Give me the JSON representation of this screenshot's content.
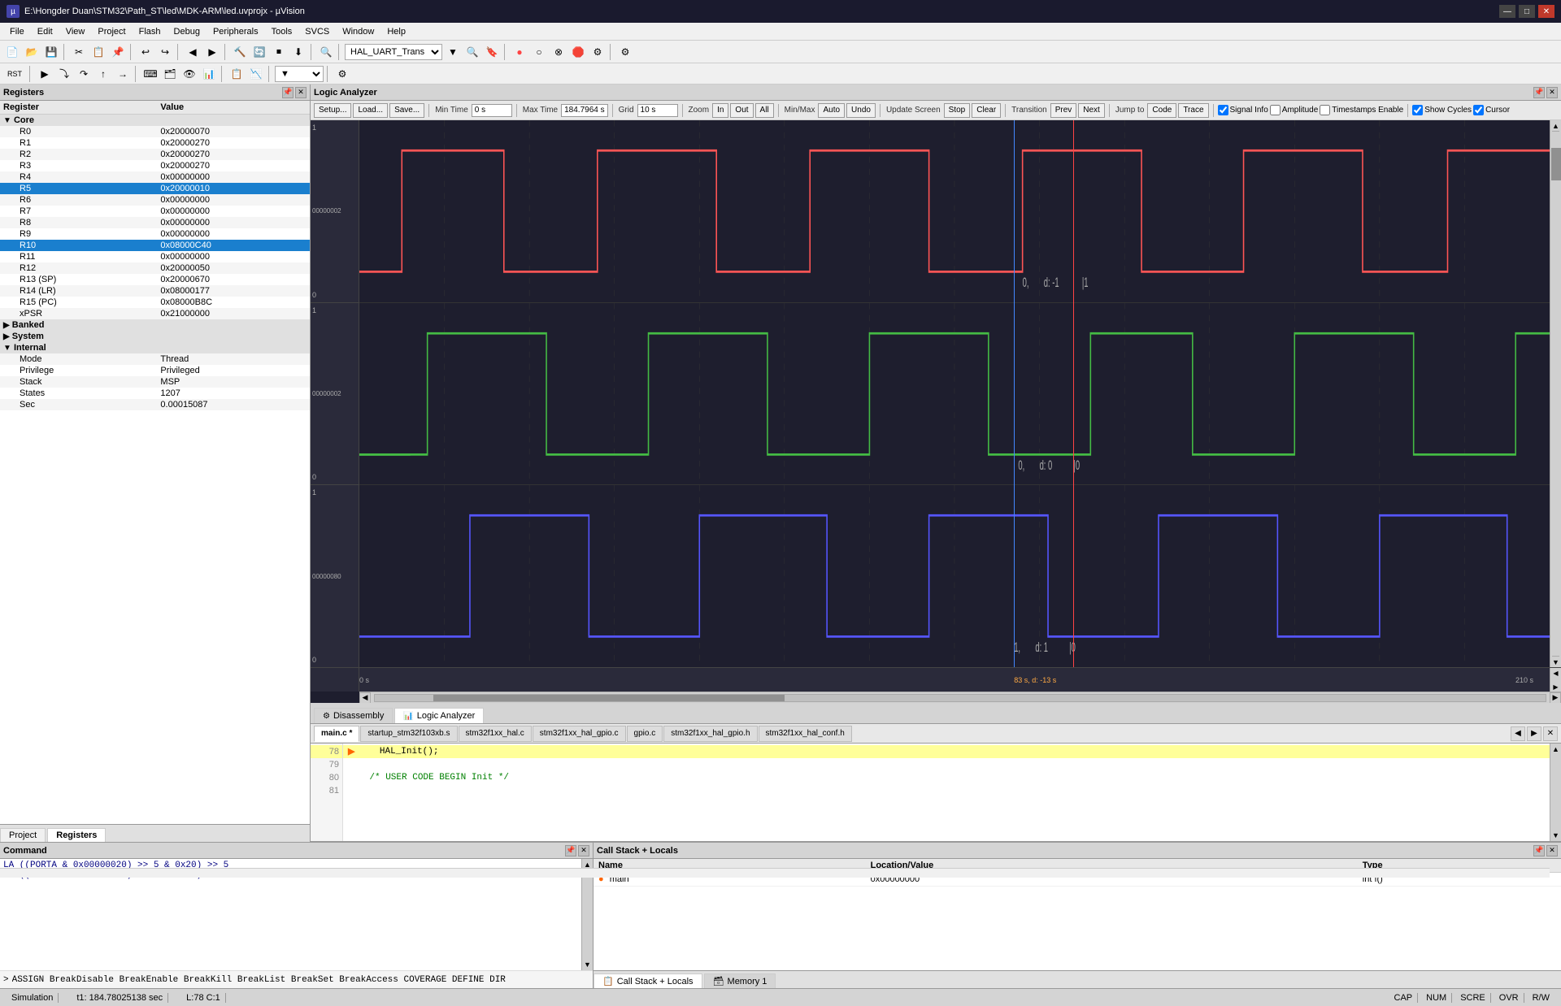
{
  "titlebar": {
    "text": "E:\\Hongder Duan\\STM32\\Path_ST\\led\\MDK-ARM\\led.uvprojx - µVision",
    "icon": "µ"
  },
  "menubar": {
    "items": [
      "File",
      "Edit",
      "View",
      "Project",
      "Flash",
      "Debug",
      "Peripherals",
      "Tools",
      "SVCS",
      "Window",
      "Help"
    ]
  },
  "toolbar": {
    "combo_value": "HAL_UART_Trans"
  },
  "registers": {
    "title": "Registers",
    "columns": [
      "Register",
      "Value"
    ],
    "sections": {
      "core": {
        "label": "Core",
        "registers": [
          {
            "name": "R0",
            "value": "0x20000070",
            "selected": false
          },
          {
            "name": "R1",
            "value": "0x20000270",
            "selected": false
          },
          {
            "name": "R2",
            "value": "0x20000270",
            "selected": false
          },
          {
            "name": "R3",
            "value": "0x20000270",
            "selected": false
          },
          {
            "name": "R4",
            "value": "0x00000000",
            "selected": false
          },
          {
            "name": "R5",
            "value": "0x20000010",
            "selected": true
          },
          {
            "name": "R6",
            "value": "0x00000000",
            "selected": false
          },
          {
            "name": "R7",
            "value": "0x00000000",
            "selected": false
          },
          {
            "name": "R8",
            "value": "0x00000000",
            "selected": false
          },
          {
            "name": "R9",
            "value": "0x00000000",
            "selected": false
          },
          {
            "name": "R10",
            "value": "0x08000C40",
            "selected": true
          },
          {
            "name": "R11",
            "value": "0x00000000",
            "selected": false
          },
          {
            "name": "R12",
            "value": "0x20000050",
            "selected": false
          },
          {
            "name": "R13 (SP)",
            "value": "0x20000670",
            "selected": false
          },
          {
            "name": "R14 (LR)",
            "value": "0x08000177",
            "selected": false
          },
          {
            "name": "R15 (PC)",
            "value": "0x08000B8C",
            "selected": false
          },
          {
            "name": "xPSR",
            "value": "0x21000000",
            "selected": false
          }
        ]
      },
      "banked": {
        "label": "Banked"
      },
      "system": {
        "label": "System"
      },
      "internal": {
        "label": "Internal",
        "rows": [
          {
            "name": "Mode",
            "value": "Thread"
          },
          {
            "name": "Privilege",
            "value": "Privileged"
          },
          {
            "name": "Stack",
            "value": "MSP"
          },
          {
            "name": "States",
            "value": "1207"
          },
          {
            "name": "Sec",
            "value": "0.00015087"
          }
        ]
      }
    }
  },
  "left_tabs": [
    {
      "label": "Project",
      "active": false
    },
    {
      "label": "Registers",
      "active": true
    }
  ],
  "logic_analyzer": {
    "title": "Logic Analyzer",
    "toolbar": {
      "setup_btn": "Setup...",
      "load_btn": "Load...",
      "save_btn": "Save...",
      "min_time_label": "Min Time",
      "min_time_val": "0 s",
      "max_time_label": "Max Time",
      "max_time_val": "184.7964 s",
      "grid_label": "Grid",
      "grid_val": "10 s",
      "zoom_label": "Zoom",
      "zoom_in": "In",
      "zoom_out": "Out",
      "zoom_all": "All",
      "minmax_label": "Min/Max",
      "auto_btn": "Auto",
      "undo_btn": "Undo",
      "update_screen_label": "Update Screen",
      "stop_btn": "Stop",
      "clear_btn": "Clear",
      "transition_label": "Transition",
      "prev_btn": "Prev",
      "next_btn": "Next",
      "jump_to_label": "Jump to",
      "code_btn": "Code",
      "trace_btn": "Trace",
      "signal_info_label": "Signal Info",
      "amplitude_label": "Amplitude",
      "timestamps_label": "Timestamps Enable",
      "show_cycles_label": "Show Cycles",
      "cursor_label": "Cursor"
    },
    "signals": [
      {
        "id": "s1",
        "bits": "00000002",
        "color": "#ff4444",
        "values": "0,d:-1,1"
      },
      {
        "id": "s2",
        "bits": "00000002",
        "color": "#44bb44",
        "values": "0,d:0,0"
      },
      {
        "id": "s3",
        "bits": "00000080",
        "color": "#4444ff",
        "values": "1,d:1,0"
      }
    ],
    "time_start": "0 s",
    "time_end": "210 s",
    "cursor_time": "83 s, d: -13 s",
    "cursor_blue_pct": 55,
    "cursor_red_pct": 60
  },
  "code_tabs": [
    {
      "label": "Disassembly",
      "icon": "⚙",
      "active": false
    },
    {
      "label": "Logic Analyzer",
      "icon": "📊",
      "active": true
    }
  ],
  "file_tabs": [
    {
      "label": "main.c *",
      "active": true
    },
    {
      "label": "startup_stm32f103xb.s",
      "active": false
    },
    {
      "label": "stm32f1xx_hal.c",
      "active": false
    },
    {
      "label": "stm32f1xx_hal_gpio.c",
      "active": false
    },
    {
      "label": "gpio.c",
      "active": false
    },
    {
      "label": "stm32f1xx_hal_gpio.h",
      "active": false
    },
    {
      "label": "stm32f1xx_hal_conf.h",
      "active": false
    }
  ],
  "code_editor": {
    "lines": [
      {
        "num": 78,
        "content": "    HAL_Init();",
        "active": true,
        "arrow": true
      },
      {
        "num": 79,
        "content": "",
        "active": false,
        "arrow": false
      },
      {
        "num": 80,
        "content": "    /* USER CODE BEGIN Init */",
        "active": false,
        "arrow": false
      },
      {
        "num": 81,
        "content": "",
        "active": false,
        "arrow": false
      }
    ]
  },
  "command": {
    "title": "Command",
    "lines": [
      "LA ((PORTA & 0x00000020) >> 5 & 0x20) >> 5",
      "LA ((PORTA & 0x00000080) >> 7 & 0x80) >> 7"
    ],
    "prompt": ">",
    "input_text": "ASSIGN BreakDisable BreakEnable BreakKill BreakList BreakSet BreakAccess COVERAGE DEFINE DIR"
  },
  "callstack": {
    "title": "Call Stack + Locals",
    "columns": [
      "Name",
      "Location/Value",
      "Type"
    ],
    "rows": [
      {
        "name": "main",
        "location": "0x00000000",
        "type": "int f()"
      }
    ]
  },
  "cs_tabs": [
    {
      "label": "Call Stack + Locals",
      "active": true,
      "icon": "📋"
    },
    {
      "label": "Memory 1",
      "active": false,
      "icon": "🗃"
    }
  ],
  "statusbar": {
    "simulation": "Simulation",
    "time_info": "t1: 184.78025138 sec",
    "line_info": "L:78 C:1",
    "caps": "CAP",
    "num": "NUM",
    "scre": "SCRE",
    "ovr": "OVR",
    "rw": "R/W"
  }
}
